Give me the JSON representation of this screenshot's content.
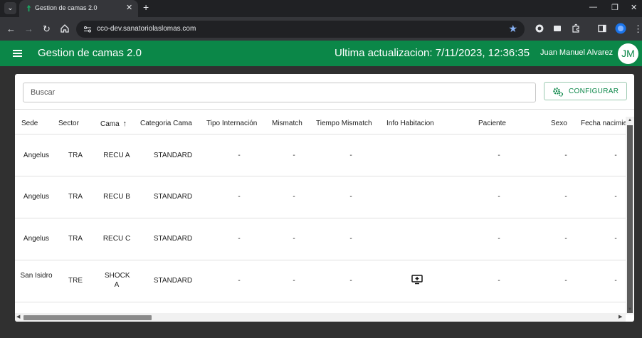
{
  "browser": {
    "tab_title": "Gestion de camas 2.0",
    "url": "cco-dev.sanatoriolaslomas.com"
  },
  "app": {
    "title": "Gestion de camas 2.0",
    "last_update": "Ultima actualizacion: 7/11/2023, 12:36:35",
    "user_name": "Juan Manuel Alvarez",
    "user_initials": "JM"
  },
  "toolbar": {
    "search_placeholder": "Buscar",
    "config_label": "CONFIGURAR"
  },
  "table": {
    "columns": [
      "Sede",
      "Sector",
      "Cama",
      "Categoria Cama",
      "Tipo Internación",
      "Mismatch",
      "Tiempo Mismatch",
      "Info Habitacion",
      "Paciente",
      "Sexo",
      "Fecha nacimie"
    ],
    "sort_indicator": "↑",
    "rows": [
      {
        "sede": "Angelus",
        "sector": "TRA",
        "cama": "RECU A",
        "categoria": "STANDARD",
        "tipo": "-",
        "mismatch": "-",
        "tiempo": "-",
        "info": "",
        "paciente": "-",
        "sexo": "-",
        "fecha": "-"
      },
      {
        "sede": "Angelus",
        "sector": "TRA",
        "cama": "RECU B",
        "categoria": "STANDARD",
        "tipo": "-",
        "mismatch": "-",
        "tiempo": "-",
        "info": "",
        "paciente": "-",
        "sexo": "-",
        "fecha": "-"
      },
      {
        "sede": "Angelus",
        "sector": "TRA",
        "cama": "RECU C",
        "categoria": "STANDARD",
        "tipo": "-",
        "mismatch": "-",
        "tiempo": "-",
        "info": "",
        "paciente": "-",
        "sexo": "-",
        "fecha": "-"
      },
      {
        "sede": "San Isidro",
        "sector": "TRE",
        "cama": "SHOCK A",
        "categoria": "STANDARD",
        "tipo": "-",
        "mismatch": "-",
        "tiempo": "-",
        "info": "monitor-add-icon",
        "paciente": "-",
        "sexo": "-",
        "fecha": "-"
      }
    ]
  },
  "colors": {
    "brand_green": "#0b8748",
    "chrome_dark": "#202124",
    "chrome_toolbar": "#35363a"
  }
}
